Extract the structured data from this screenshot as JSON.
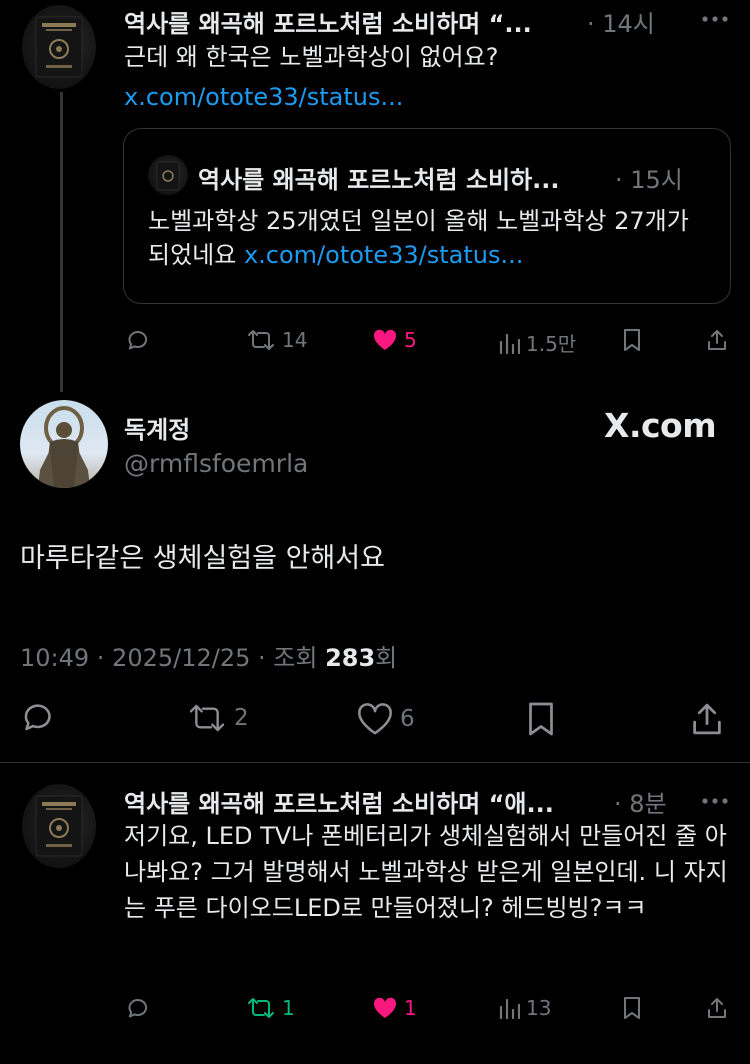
{
  "colors": {
    "background": "#000000",
    "text": "#e7e9ea",
    "muted": "#71767b",
    "link": "#1d9bf0",
    "like": "#f91880",
    "retweet": "#00ba7c",
    "border": "#2f3336"
  },
  "reply1": {
    "author": "역사를 왜곡해 포르노처럼 소비하며 “...",
    "time": "· 14시",
    "text": "근데 왜 한국은 노벨과학상이 없어요?",
    "link": "x.com/otote33/status...",
    "quote": {
      "author": "역사를 왜곡해 포르노처럼 소비하...",
      "time": "· 15시",
      "text": "노벨과학상 25개였던 일본이 올해 노벨과학상 27개가 되었네요",
      "link": "x.com/otote33/status..."
    },
    "actions": {
      "reply_icon": "reply-icon",
      "retweets": "14",
      "likes": "5",
      "views": "1.5만"
    }
  },
  "main": {
    "display_name": "독계정",
    "handle": "@rmflsfoemrla",
    "watermark": "X.com",
    "text": "마루타같은 생체실험을 안해서요",
    "timestamp": "10:49 · 2025/12/25 · 조회 ",
    "views": "283",
    "views_suffix": "회",
    "retweets": "2",
    "likes": "6"
  },
  "reply2": {
    "author": "역사를 왜곡해 포르노처럼 소비하며 “애...",
    "time": "· 8분",
    "text": "저기요, LED TV나 폰베터리가 생체실험해서 만들어진 줄 아나봐요? 그거 발명해서 노벨과학상 받은게 일본인데. 니 자지는 푸른 다이오드LED로 만들어졌니? 헤드빙빙?ㅋㅋ",
    "actions": {
      "retweets": "1",
      "likes": "1",
      "views": "13"
    }
  }
}
